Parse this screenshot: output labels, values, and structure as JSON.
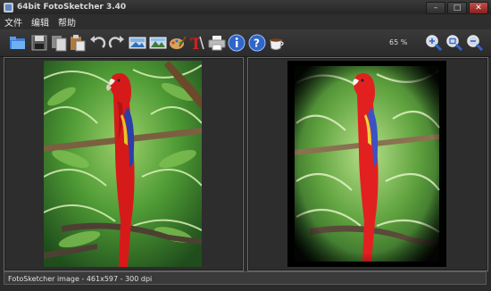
{
  "window": {
    "title": "64bit FotoSketcher 3.40"
  },
  "menu": {
    "items": [
      "文件",
      "编辑",
      "帮助"
    ]
  },
  "toolbar": {
    "buttons": [
      "open-folder-icon",
      "save-icon",
      "copy-icon",
      "paste-icon",
      "undo-icon",
      "redo-icon",
      "original-image-icon",
      "result-image-icon",
      "paint-palette-icon",
      "text-icon",
      "print-icon",
      "info-icon",
      "help-icon",
      "coffee-icon",
      "zoom-in-icon",
      "zoom-fit-icon",
      "zoom-out-icon"
    ],
    "zoom_level": "65 %"
  },
  "status": {
    "text": "FotoSketcher image - 461x597 - 300 dpi"
  },
  "colors": {
    "background": "#2b2b2b",
    "pane_border": "#6a6a6a",
    "accent_blue": "#2f66c8"
  }
}
